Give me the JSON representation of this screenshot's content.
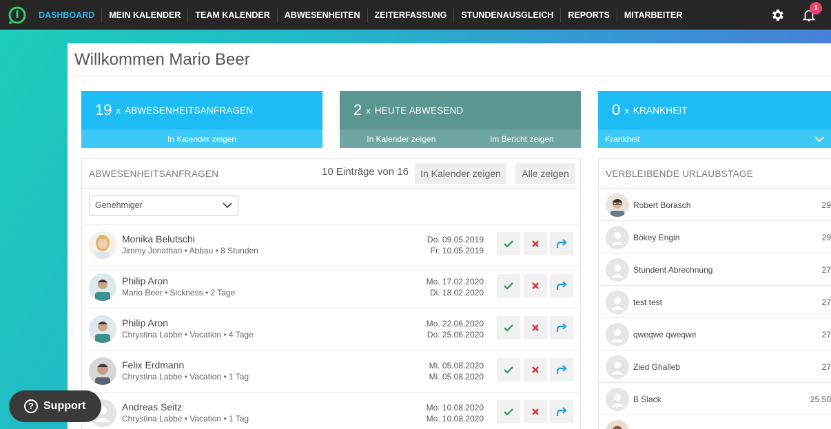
{
  "nav": {
    "items": [
      "DASHBOARD",
      "MEIN KALENDER",
      "TEAM KALENDER",
      "ABWESENHEITEN",
      "ZEITERFASSUNG",
      "STUNDENAUSGLEICH",
      "REPORTS",
      "MITARBEITER"
    ],
    "notifications": "1",
    "accent": "#29b6e8"
  },
  "page": {
    "welcome": "Willkommen Mario Beer"
  },
  "cards": {
    "requests": {
      "count": "19",
      "x": "x",
      "label": "ABWESENHEITSANFRAGEN",
      "link": "In Kalender zeigen",
      "color": "#1ebcf5"
    },
    "absent": {
      "count": "2",
      "x": "x",
      "label": "HEUTE ABWESEND",
      "link1": "In Kalender zeigen",
      "link2": "Im Bericht zeigen",
      "color": "#5b9693"
    },
    "sick": {
      "count": "0",
      "x": "x",
      "label": "KRANKHEIT",
      "dropdown": "Krankheit",
      "color": "#1ebcf5"
    }
  },
  "requests_panel": {
    "title": "ABWESENHEITSANFRAGEN",
    "entries": "10 Einträge von 16",
    "calendar_button": "In Kalender zeigen",
    "all_button": "Alle zeigen",
    "filter": "Genehmiger",
    "rows": [
      {
        "name": "Monika Belutschi",
        "sub": "Jimmy Jonathan • Abbau • 8 Stunden",
        "from": "Do. 09.05.2019",
        "to": "Fr. 10.05.2019"
      },
      {
        "name": "Philip Aron",
        "sub": "Mario Beer • Sickness • 2 Tage",
        "from": "Mo. 17.02.2020",
        "to": "Di. 18.02.2020"
      },
      {
        "name": "Philip Aron",
        "sub": "Chrystina Labbe • Vacation • 4 Tage",
        "from": "Mo. 22.06.2020",
        "to": "Do. 25.06.2020"
      },
      {
        "name": "Felix Erdmann",
        "sub": "Chrystina Labbe • Vacation • 1 Tag",
        "from": "Mi. 05.08.2020",
        "to": "Mi. 05.08.2020"
      },
      {
        "name": "Andreas Seitz",
        "sub": "Chrystina Labbe • Vacation • 1 Tag",
        "from": "Mo. 10.08.2020",
        "to": "Mo. 10.08.2020"
      }
    ]
  },
  "vacation_panel": {
    "title": "VERBLEIBENDE URLAUBSTAGE",
    "rows": [
      {
        "name": "Robert Borasch",
        "days": "29"
      },
      {
        "name": "Bökey Engin",
        "days": "29"
      },
      {
        "name": "Stundent Abrechnung",
        "days": "27"
      },
      {
        "name": "test test",
        "days": "27"
      },
      {
        "name": "qweqwe qweqwe",
        "days": "27"
      },
      {
        "name": "Zied Ghalleb",
        "days": "27"
      },
      {
        "name": "B Slack",
        "days": "25.50"
      }
    ]
  },
  "support": {
    "label": "Support",
    "icon": "question-icon"
  }
}
